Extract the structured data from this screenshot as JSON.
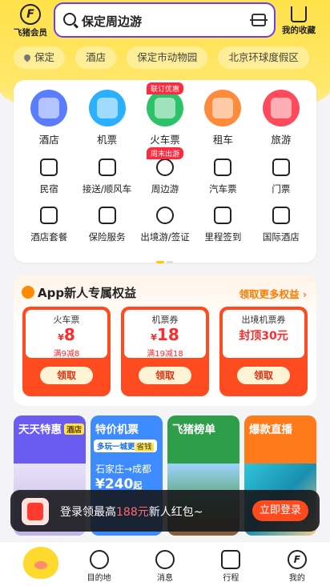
{
  "header": {
    "member_logo": "F",
    "member_label": "飞猪会员",
    "search_query": "保定周边游",
    "favorites_label": "我的收藏"
  },
  "chips": [
    "保定",
    "酒店",
    "保定市动物园",
    "北京环球度假区"
  ],
  "services": {
    "big": [
      {
        "label": "酒店",
        "icon": "hotel-icon",
        "color": "#5a7dff",
        "badge": ""
      },
      {
        "label": "机票",
        "icon": "plane-icon",
        "color": "#2ab0ff",
        "badge": ""
      },
      {
        "label": "火车票",
        "icon": "train-icon",
        "color": "#2cc26a",
        "badge": "联订优惠"
      },
      {
        "label": "租车",
        "icon": "car-icon",
        "color": "#ff8a3c",
        "badge": ""
      },
      {
        "label": "旅游",
        "icon": "beach-icon",
        "color": "#ff4a5c",
        "badge": ""
      }
    ],
    "row2": [
      {
        "label": "民宿",
        "icon": "house-icon",
        "badge": ""
      },
      {
        "label": "接送/顺风车",
        "icon": "taxi-icon",
        "badge": ""
      },
      {
        "label": "周边游",
        "icon": "nearby-icon",
        "badge": "周末出游"
      },
      {
        "label": "汽车票",
        "icon": "bus-icon",
        "badge": ""
      },
      {
        "label": "门票",
        "icon": "ticket-icon",
        "badge": ""
      }
    ],
    "row3": [
      {
        "label": "酒店套餐",
        "icon": "package-icon"
      },
      {
        "label": "保险服务",
        "icon": "shield-icon"
      },
      {
        "label": "出境游/签证",
        "icon": "globe-icon"
      },
      {
        "label": "里程签到",
        "icon": "checkin-icon"
      },
      {
        "label": "国际酒店",
        "icon": "intl-hotel-icon"
      }
    ]
  },
  "benefits": {
    "title": "App新人专属权益",
    "more": "领取更多权益",
    "coupons": [
      {
        "type": "火车票",
        "currency": "¥",
        "value": "8",
        "condition": "满9减8",
        "button": "领取"
      },
      {
        "type": "机票券",
        "currency": "¥",
        "value": "18",
        "condition": "满19减18",
        "button": "领取"
      },
      {
        "type": "出境机票券",
        "currency": "",
        "value": "封顶30元",
        "condition": "",
        "button": "领取"
      }
    ]
  },
  "promos": [
    {
      "title": "天天特惠",
      "tag": "酒店",
      "color": "#6a5cf0"
    },
    {
      "title": "特价机票",
      "tag": "",
      "sub": "多玩一城更",
      "sub_hl": "省钱",
      "route": "石家庄→成都",
      "price": "¥240",
      "price_suffix": "起",
      "color": "#3d8bff"
    },
    {
      "title": "飞猪榜单",
      "tag": "",
      "color": "#2f9e4a"
    },
    {
      "title": "爆款直播",
      "tag": "",
      "color": "#ff7a1a"
    }
  ],
  "toast": {
    "prefix": "登录领最高",
    "amount": "188元",
    "suffix": "新人红包~",
    "button": "立即登录"
  },
  "tabbar": [
    {
      "label": "",
      "icon": "pig-home-icon"
    },
    {
      "label": "目的地",
      "icon": "planet-icon"
    },
    {
      "label": "消息",
      "icon": "message-icon"
    },
    {
      "label": "行程",
      "icon": "calendar-icon"
    },
    {
      "label": "我的",
      "icon": "profile-icon"
    }
  ]
}
